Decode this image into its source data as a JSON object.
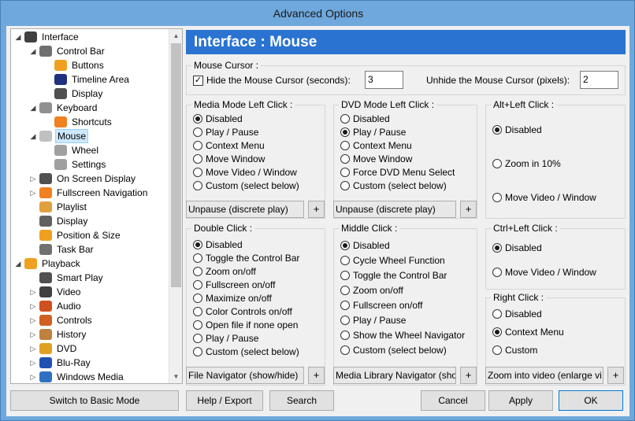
{
  "window": {
    "title": "Advanced Options"
  },
  "tree": {
    "items": [
      {
        "label": "Interface",
        "icon": "interface-icon",
        "expander": "expanded",
        "color": "#404040"
      },
      {
        "label": "Control Bar",
        "icon": "control-bar-icon",
        "expander": "expanded",
        "color": "#707070"
      },
      {
        "label": "Buttons",
        "icon": "buttons-icon",
        "expander": "",
        "color": "#f0a020"
      },
      {
        "label": "Timeline Area",
        "icon": "timeline-icon",
        "expander": "",
        "color": "#203080"
      },
      {
        "label": "Display",
        "icon": "display-icon",
        "expander": "",
        "color": "#505050"
      },
      {
        "label": "Keyboard",
        "icon": "keyboard-icon",
        "expander": "expanded",
        "color": "#909090"
      },
      {
        "label": "Shortcuts",
        "icon": "shortcut-icon",
        "expander": "",
        "color": "#f08020"
      },
      {
        "label": "Mouse",
        "icon": "mouse-icon",
        "expander": "expanded",
        "color": "#c0c0c0"
      },
      {
        "label": "Wheel",
        "icon": "wheel-icon",
        "expander": "",
        "color": "#a0a0a0"
      },
      {
        "label": "Settings",
        "icon": "settings-icon",
        "expander": "",
        "color": "#a0a0a0"
      },
      {
        "label": "On Screen Display",
        "icon": "osd-icon",
        "expander": "collapsed",
        "color": "#505050"
      },
      {
        "label": "Fullscreen Navigation",
        "icon": "fullscreen-icon",
        "expander": "collapsed",
        "color": "#f08020"
      },
      {
        "label": "Playlist",
        "icon": "playlist-icon",
        "expander": "",
        "color": "#e0a040"
      },
      {
        "label": "Display",
        "icon": "display-icon",
        "expander": "",
        "color": "#606060"
      },
      {
        "label": "Position & Size",
        "icon": "position-icon",
        "expander": "",
        "color": "#f0a020"
      },
      {
        "label": "Task Bar",
        "icon": "taskbar-icon",
        "expander": "",
        "color": "#707070"
      },
      {
        "label": "Playback",
        "icon": "playback-icon",
        "expander": "expanded",
        "color": "#f0a020"
      },
      {
        "label": "Smart Play",
        "icon": "smart-play-icon",
        "expander": "",
        "color": "#505050"
      },
      {
        "label": "Video",
        "icon": "video-icon",
        "expander": "collapsed",
        "color": "#404040"
      },
      {
        "label": "Audio",
        "icon": "audio-icon",
        "expander": "collapsed",
        "color": "#d05020"
      },
      {
        "label": "Controls",
        "icon": "controls-icon",
        "expander": "collapsed",
        "color": "#d06020"
      },
      {
        "label": "History",
        "icon": "history-icon",
        "expander": "collapsed",
        "color": "#c08040"
      },
      {
        "label": "DVD",
        "icon": "dvd-icon",
        "expander": "collapsed",
        "color": "#e0a020"
      },
      {
        "label": "Blu-Ray",
        "icon": "bluray-icon",
        "expander": "collapsed",
        "color": "#2050b0"
      },
      {
        "label": "Windows Media",
        "icon": "windows-media-icon",
        "expander": "collapsed",
        "color": "#3070c0"
      }
    ]
  },
  "header": {
    "title": "Interface : Mouse"
  },
  "cursor": {
    "group_title": "Mouse Cursor :",
    "hide_label": "Hide the Mouse Cursor (seconds):",
    "hide_checked": true,
    "hide_value": "3",
    "unhide_label": "Unhide the Mouse Cursor (pixels):",
    "unhide_value": "2"
  },
  "media_left": {
    "title": "Media Mode Left Click :",
    "options": [
      "Disabled",
      "Play / Pause",
      "Context Menu",
      "Move Window",
      "Move Video / Window",
      "Custom (select below)"
    ],
    "selected": 0,
    "combo": "Unpause (discrete play)"
  },
  "dvd_left": {
    "title": "DVD Mode Left Click :",
    "options": [
      "Disabled",
      "Play / Pause",
      "Context Menu",
      "Move Window",
      "Force DVD Menu Select",
      "Custom (select below)"
    ],
    "selected": 1,
    "combo": "Unpause (discrete play)"
  },
  "alt_left": {
    "title": "Alt+Left Click :",
    "options": [
      "Disabled",
      "Zoom in 10%",
      "Move Video / Window"
    ],
    "selected": 0
  },
  "double_click": {
    "title": "Double Click :",
    "options": [
      "Disabled",
      "Toggle the Control Bar",
      "Zoom on/off",
      "Fullscreen on/off",
      "Maximize on/off",
      "Color Controls on/off",
      "Open file if none open",
      "Play / Pause",
      "Custom (select below)"
    ],
    "selected": 0,
    "combo": "File Navigator (show/hide)"
  },
  "middle_click": {
    "title": "Middle Click :",
    "options": [
      "Disabled",
      "Cycle Wheel Function",
      "Toggle the Control Bar",
      "Zoom on/off",
      "Fullscreen on/off",
      "Play / Pause",
      "Show the Wheel Navigator",
      "Custom (select below)"
    ],
    "selected": 0,
    "combo": "Media Library Navigator (sho"
  },
  "ctrl_left": {
    "title": "Ctrl+Left Click :",
    "options": [
      "Disabled",
      "Move Video / Window"
    ],
    "selected": 0
  },
  "right_click": {
    "title": "Right Click :",
    "options": [
      "Disabled",
      "Context Menu",
      "Custom"
    ],
    "selected": 1,
    "combo": "Zoom into video (enlarge vi"
  },
  "plus_label": "+",
  "buttons": {
    "basic_mode": "Switch to Basic Mode",
    "help_export": "Help / Export",
    "search": "Search",
    "cancel": "Cancel",
    "apply": "Apply",
    "ok": "OK"
  }
}
